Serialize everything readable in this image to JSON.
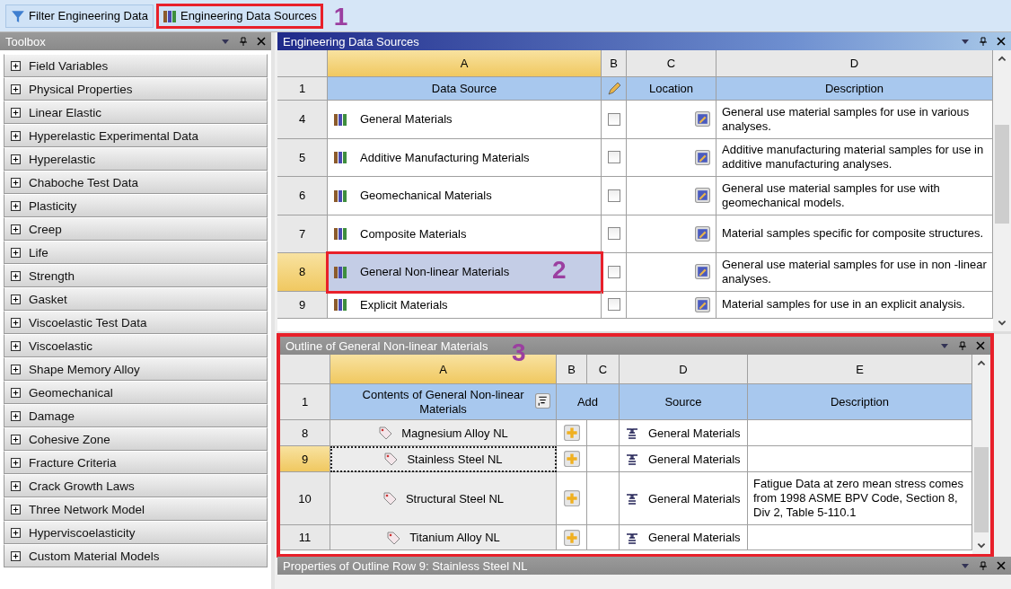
{
  "toolbar": {
    "buttons": [
      {
        "label": "Filter Engineering Data",
        "kind": "filter"
      },
      {
        "label": "Engineering Data Sources",
        "kind": "books",
        "annotation": "1"
      }
    ]
  },
  "toolbox": {
    "title": "Toolbox",
    "items": [
      "Field Variables",
      "Physical Properties",
      "Linear Elastic",
      "Hyperelastic Experimental Data",
      "Hyperelastic",
      "Chaboche Test Data",
      "Plasticity",
      "Creep",
      "Life",
      "Strength",
      "Gasket",
      "Viscoelastic Test Data",
      "Viscoelastic",
      "Shape Memory Alloy",
      "Geomechanical",
      "Damage",
      "Cohesive Zone",
      "Fracture Criteria",
      "Crack Growth Laws",
      "Three Network Model",
      "Hyperviscoelasticity",
      "Custom Material Models"
    ]
  },
  "sources": {
    "title": "Engineering Data Sources",
    "columns": [
      "A",
      "B",
      "C",
      "D"
    ],
    "header": {
      "row": "1",
      "data_source": "Data Source",
      "location": "Location",
      "description": "Description"
    },
    "rows": [
      {
        "row": "4",
        "name": "General Materials",
        "checked": false,
        "selected": false,
        "description": "General use material samples for use in various analyses."
      },
      {
        "row": "5",
        "name": "Additive Manufacturing Materials",
        "checked": false,
        "selected": false,
        "description": "Additive manufacturing material samples for use in additive manufacturing analyses."
      },
      {
        "row": "6",
        "name": "Geomechanical Materials",
        "checked": false,
        "selected": false,
        "description": "General use material samples for use with geomechanical models."
      },
      {
        "row": "7",
        "name": "Composite Materials",
        "checked": false,
        "selected": false,
        "description": "Material samples specific for composite structures."
      },
      {
        "row": "8",
        "name": "General Non-linear Materials",
        "checked": false,
        "selected": true,
        "annotation": "2",
        "description": "General use material samples for use in non -linear analyses."
      },
      {
        "row": "9",
        "name": "Explicit Materials",
        "checked": false,
        "selected": false,
        "description": "Material samples for use in an explicit analysis."
      }
    ]
  },
  "outline": {
    "title": "Outline of General Non-linear Materials",
    "annotation": "3",
    "columns": [
      "A",
      "B",
      "C",
      "D",
      "E"
    ],
    "header": {
      "row": "1",
      "contents": "Contents of General Non-linear Materials",
      "add": "Add",
      "source": "Source",
      "description": "Description"
    },
    "rows": [
      {
        "row": "8",
        "name": "Magnesium Alloy NL",
        "source": "General Materials",
        "selected": false
      },
      {
        "row": "9",
        "name": "Stainless Steel NL",
        "source": "General Materials",
        "selected": true
      },
      {
        "row": "10",
        "name": "Structural Steel NL",
        "source": "General Materials",
        "description": "Fatigue Data at zero mean stress comes from 1998 ASME BPV Code, Section 8, Div 2, Table 5-110.1",
        "selected": false
      },
      {
        "row": "11",
        "name": "Titanium Alloy NL",
        "source": "General Materials",
        "selected": false
      }
    ]
  },
  "properties": {
    "title": "Properties of Outline Row 9: Stainless Steel NL"
  }
}
